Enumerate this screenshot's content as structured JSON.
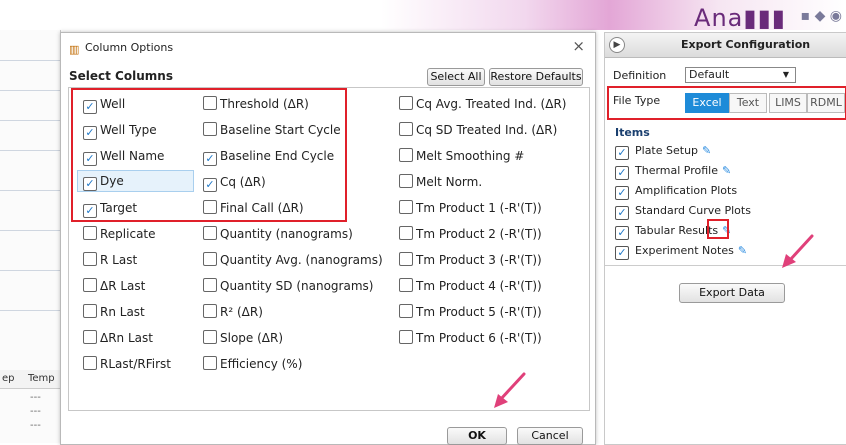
{
  "app": {
    "brand": "Ana▮▮▮"
  },
  "background": {
    "table_headers": [
      "ep",
      "Temp"
    ],
    "cells": [
      "---",
      "---",
      "---"
    ]
  },
  "dialog": {
    "title": "Column Options",
    "close": "×",
    "heading": "Select Columns",
    "select_all": "Select All",
    "restore_defaults": "Restore Defaults",
    "ok": "OK",
    "cancel": "Cancel",
    "columns": [
      [
        {
          "label": "Well",
          "checked": true
        },
        {
          "label": "Well Type",
          "checked": true
        },
        {
          "label": "Well Name",
          "checked": true
        },
        {
          "label": "Dye",
          "checked": true
        },
        {
          "label": "Target",
          "checked": true
        },
        {
          "label": "Replicate",
          "checked": false
        },
        {
          "label": "R Last",
          "checked": false
        },
        {
          "label": "ΔR Last",
          "checked": false
        },
        {
          "label": "Rn Last",
          "checked": false
        },
        {
          "label": "ΔRn Last",
          "checked": false
        },
        {
          "label": "RLast/RFirst",
          "checked": false
        }
      ],
      [
        {
          "label": "Threshold (ΔR)",
          "checked": false
        },
        {
          "label": "Baseline Start Cycle",
          "checked": false
        },
        {
          "label": "Baseline End Cycle",
          "checked": true
        },
        {
          "label": "Cq (ΔR)",
          "checked": true
        },
        {
          "label": "Final Call (ΔR)",
          "checked": false
        },
        {
          "label": "Quantity (nanograms)",
          "checked": false
        },
        {
          "label": "Quantity Avg. (nanograms)",
          "checked": false
        },
        {
          "label": "Quantity SD (nanograms)",
          "checked": false
        },
        {
          "label": "R² (ΔR)",
          "checked": false
        },
        {
          "label": "Slope (ΔR)",
          "checked": false
        },
        {
          "label": "Efficiency (%)",
          "checked": false
        }
      ],
      [
        {
          "label": "Cq Avg. Treated Ind. (ΔR)",
          "checked": false
        },
        {
          "label": "Cq SD Treated Ind. (ΔR)",
          "checked": false
        },
        {
          "label": "Melt Smoothing #",
          "checked": false
        },
        {
          "label": "Melt Norm.",
          "checked": false
        },
        {
          "label": "Tm Product 1 (-R'(T))",
          "checked": false
        },
        {
          "label": "Tm Product 2 (-R'(T))",
          "checked": false
        },
        {
          "label": "Tm Product 3 (-R'(T))",
          "checked": false
        },
        {
          "label": "Tm Product 4 (-R'(T))",
          "checked": false
        },
        {
          "label": "Tm Product 5 (-R'(T))",
          "checked": false
        },
        {
          "label": "Tm Product 6 (-R'(T))",
          "checked": false
        }
      ]
    ]
  },
  "export": {
    "title": "Export Configuration",
    "definition_label": "Definition",
    "definition_value": "Default",
    "file_type_label": "File Type",
    "file_types": [
      "Excel",
      "Text",
      "LIMS",
      "RDML"
    ],
    "active_file_type": "Excel",
    "items_title": "Items",
    "items": [
      {
        "label": "Plate Setup",
        "checked": true,
        "editable": true
      },
      {
        "label": "Thermal Profile",
        "checked": true,
        "editable": true
      },
      {
        "label": "Amplification Plots",
        "checked": true,
        "editable": false
      },
      {
        "label": "Standard Curve Plots",
        "checked": true,
        "editable": false
      },
      {
        "label": "Tabular Results",
        "checked": true,
        "editable": true
      },
      {
        "label": "Experiment Notes",
        "checked": true,
        "editable": true
      }
    ],
    "export_button": "Export Data"
  },
  "colors": {
    "highlight_red": "#e0202a",
    "arrow_pink": "#e0407a",
    "accent_blue": "#1e8bd8"
  }
}
